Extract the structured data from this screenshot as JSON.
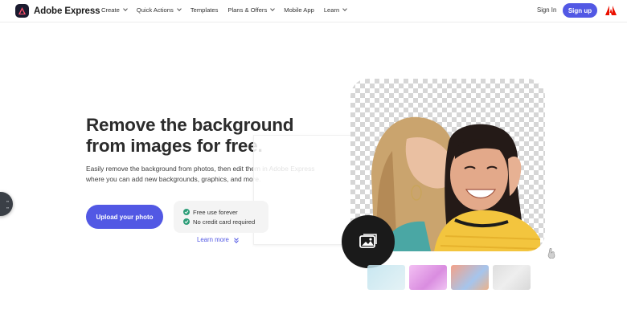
{
  "header": {
    "brand": "Adobe Express",
    "nav": [
      {
        "label": "Create",
        "dropdown": true
      },
      {
        "label": "Quick Actions",
        "dropdown": true
      },
      {
        "label": "Templates",
        "dropdown": false
      },
      {
        "label": "Plans & Offers",
        "dropdown": true
      },
      {
        "label": "Mobile App",
        "dropdown": false
      },
      {
        "label": "Learn",
        "dropdown": true
      }
    ],
    "signin": "Sign In",
    "signup": "Sign up"
  },
  "hero": {
    "title_line1": "Remove the background",
    "title_line2": "from images for free.",
    "description": "Easily remove the background from photos, then edit them in Adobe Express where you can add new backgrounds, graphics, and more.",
    "upload_label": "Upload your photo",
    "features": [
      "Free use forever",
      "No credit card required"
    ],
    "learn_more": "Learn more"
  },
  "colors": {
    "accent": "#5258e4",
    "check": "#2d9d78",
    "adobe_red": "#eb1000"
  },
  "icons": {
    "brand": "adobe-express-logo-icon",
    "corporate": "adobe-logo-icon",
    "image_upload": "image-icon",
    "feature_check": "check-circle-icon",
    "learn_more": "double-chevron-down-icon"
  }
}
